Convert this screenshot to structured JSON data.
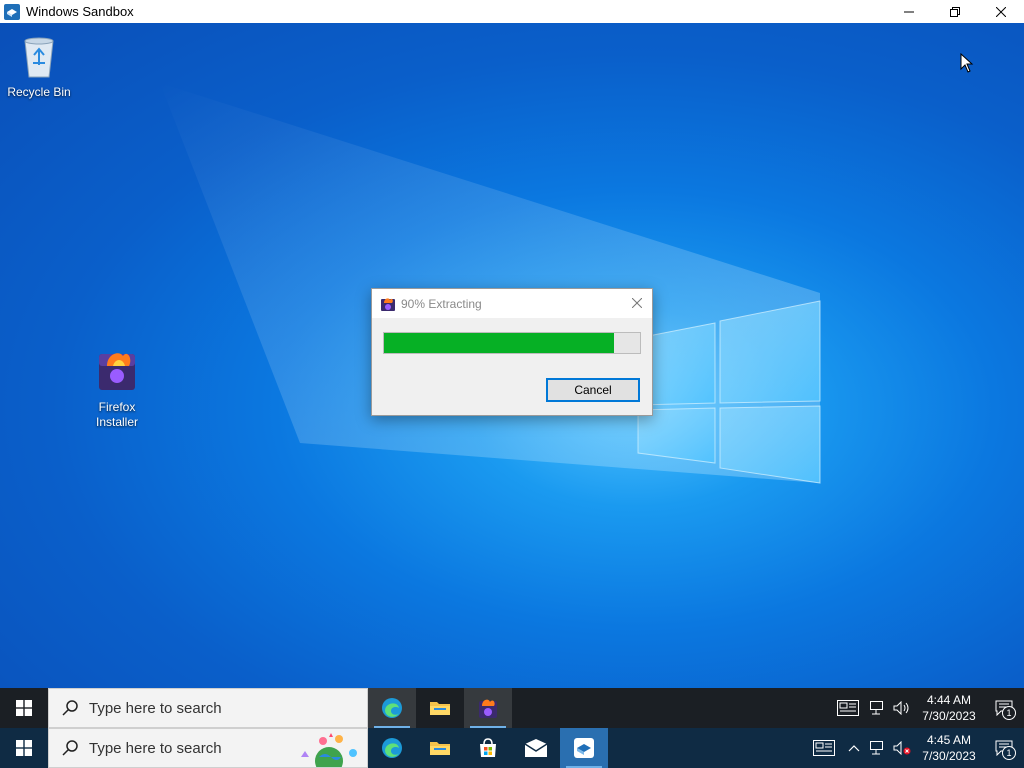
{
  "window": {
    "title": "Windows Sandbox"
  },
  "desktop": {
    "icons": [
      {
        "label": "Recycle Bin"
      },
      {
        "label": "Firefox Installer"
      }
    ]
  },
  "dialog": {
    "title": "90% Extracting",
    "progress_percent": 90,
    "cancel_label": "Cancel"
  },
  "inner_taskbar": {
    "search_placeholder": "Type here to search",
    "time": "4:44 AM",
    "date": "7/30/2023",
    "notification_count": "1"
  },
  "outer_taskbar": {
    "search_placeholder": "Type here to search",
    "time": "4:45 AM",
    "date": "7/30/2023",
    "notification_count": "1"
  },
  "colors": {
    "progress_fill": "#06b025",
    "accent": "#0078d7"
  }
}
